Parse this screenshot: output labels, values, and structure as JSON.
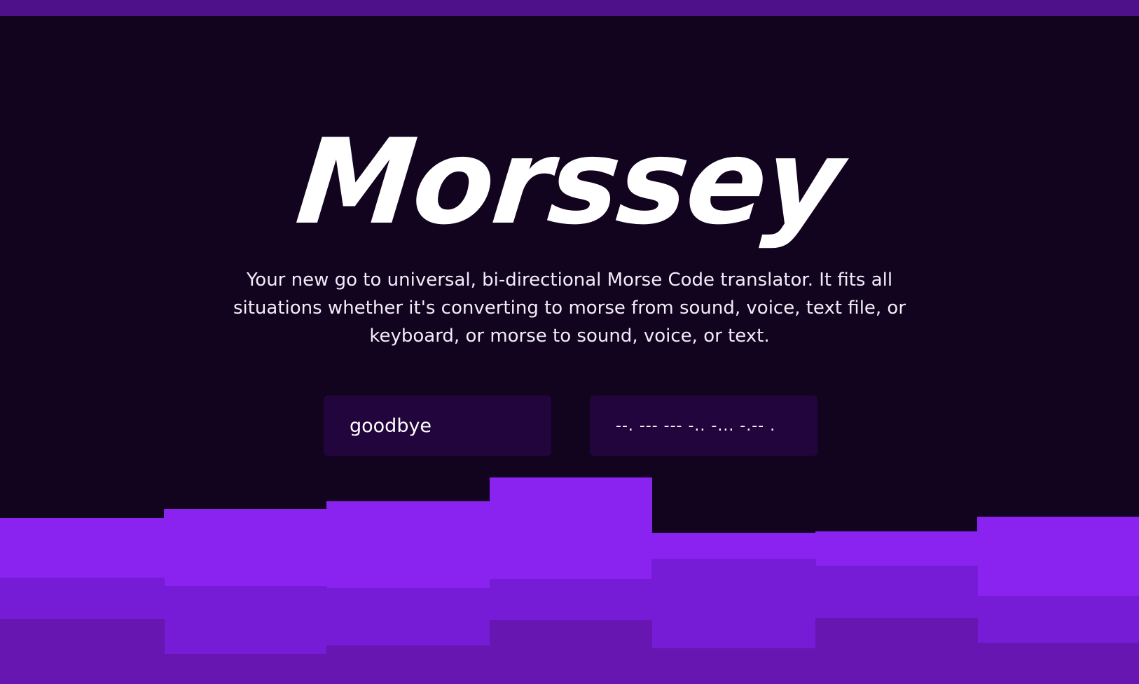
{
  "app": {
    "title": "Morssey",
    "tagline": "Your new go to universal, bi-directional Morse Code translator. It fits all situations whether it's converting to morse from sound, voice, text file, or keyboard, or morse to sound, voice, or text."
  },
  "translator": {
    "text_value": "goodbye",
    "morse_value": "--. --- --- -.. -... -.-- ."
  },
  "colors": {
    "background": "#12031f",
    "top_bar": "#4f118a",
    "input_bg": "#23053d",
    "wave_light": "#8a22f0",
    "wave_mid": "#761cd6",
    "wave_dark": "#6716b2"
  }
}
